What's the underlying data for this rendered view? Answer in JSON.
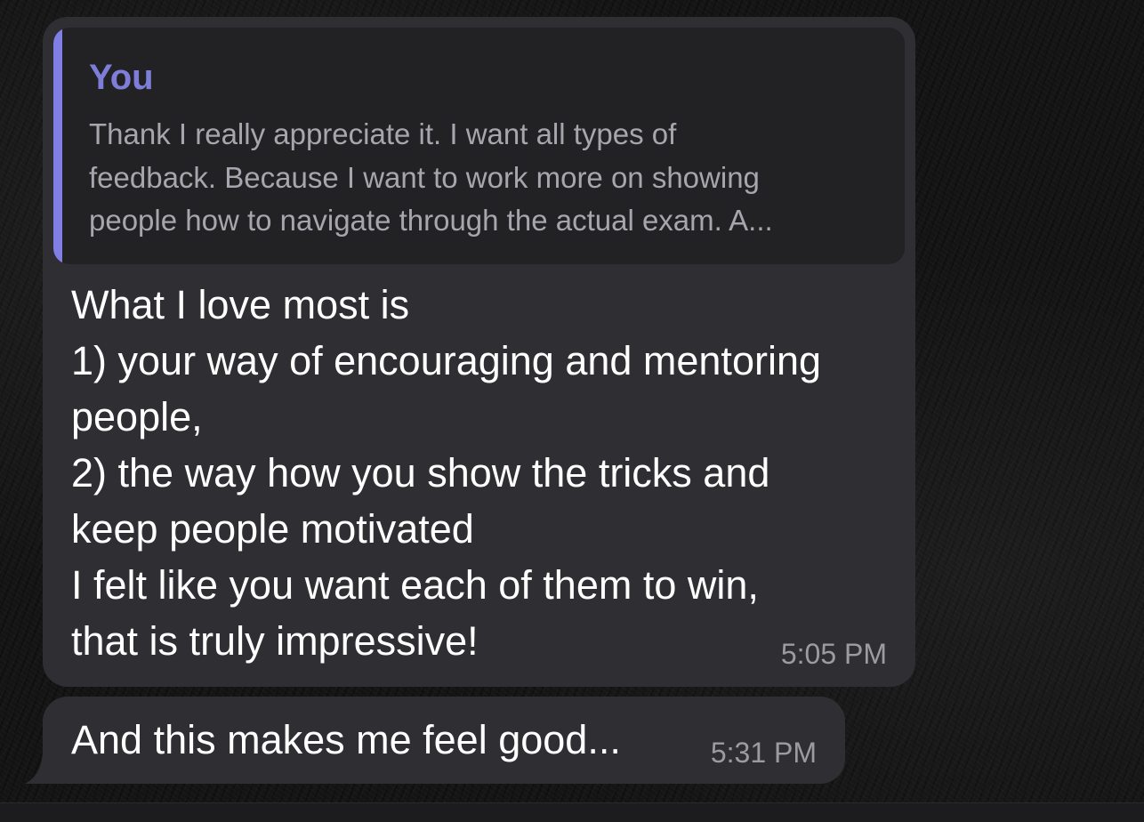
{
  "messages": [
    {
      "reply": {
        "author": "You",
        "lines": [
          "Thank I really appreciate it. I want all types of",
          "feedback. Because I want to work more on showing",
          "people how to navigate through the actual exam. A..."
        ]
      },
      "lines": [
        "What I love most is",
        "1) your way of encouraging and mentoring",
        "people,",
        "2) the way how you show the tricks and",
        "keep people motivated",
        "I felt like you want each of them to win,",
        "that is truly impressive!"
      ],
      "time": "5:05 PM"
    },
    {
      "text": "And this makes me feel good...",
      "time": "5:31 PM"
    }
  ],
  "colors": {
    "bubble": "#2f2f33",
    "reply_background": "#222225",
    "reply_accent": "#7f7fe6",
    "reply_author": "#7e7ed8",
    "timestamp": "#9b9ba1"
  }
}
